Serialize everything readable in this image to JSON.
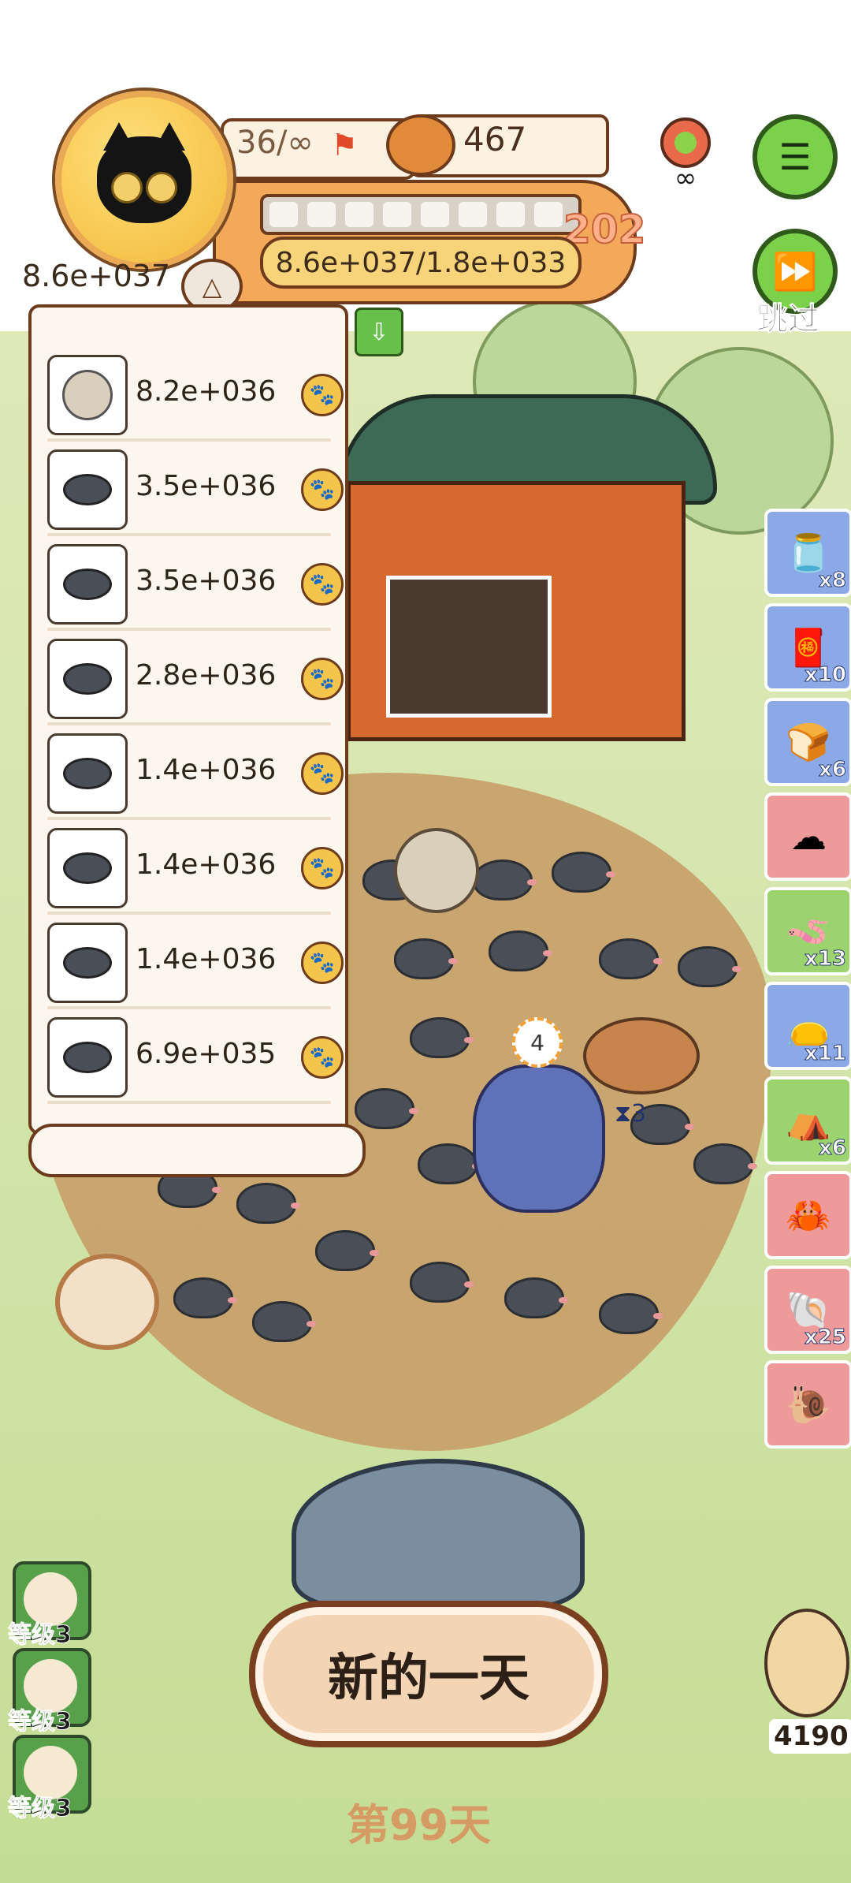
{
  "hud": {
    "player_level": "36/∞",
    "cans": "467",
    "progress_badge": "202",
    "progress_value": "8.6e+037/1.8e+033"
  },
  "skip_button": {
    "label": "跳过"
  },
  "leaderboard": {
    "total": "8.6e+037",
    "rows": [
      {
        "value": "8.2e+036",
        "animal": "hedgehog"
      },
      {
        "value": "3.5e+036",
        "animal": "mole"
      },
      {
        "value": "3.5e+036",
        "animal": "mole"
      },
      {
        "value": "2.8e+036",
        "animal": "mole"
      },
      {
        "value": "1.4e+036",
        "animal": "mole"
      },
      {
        "value": "1.4e+036",
        "animal": "mole"
      },
      {
        "value": "1.4e+036",
        "animal": "mole"
      },
      {
        "value": "6.9e+035",
        "animal": "mole"
      }
    ]
  },
  "inventory": [
    {
      "icon": "jar-icon",
      "count": "x8",
      "color": "blue"
    },
    {
      "icon": "charm-icon",
      "count": "x10",
      "color": "blue"
    },
    {
      "icon": "bread-icon",
      "count": "x6",
      "color": "blue"
    },
    {
      "icon": "cloud-icon",
      "count": "",
      "color": "pink"
    },
    {
      "icon": "worm-icon",
      "count": "x13",
      "color": "green"
    },
    {
      "icon": "sack-icon",
      "count": "x11",
      "color": "blue"
    },
    {
      "icon": "tent-icon",
      "count": "x6",
      "color": "green"
    },
    {
      "icon": "crab-icon",
      "count": "",
      "color": "pink"
    },
    {
      "icon": "shell-icon",
      "count": "x25",
      "color": "pink"
    },
    {
      "icon": "snail-icon",
      "count": "",
      "color": "pink"
    }
  ],
  "level_buttons": [
    {
      "label": "等级3"
    },
    {
      "label": "等级3"
    },
    {
      "label": "等级3"
    }
  ],
  "scene": {
    "timer_badge": "4",
    "hourglass_count": "3"
  },
  "new_day_button": {
    "label": "新的一天"
  },
  "day_label": "第99天",
  "bottom_score": "4190"
}
